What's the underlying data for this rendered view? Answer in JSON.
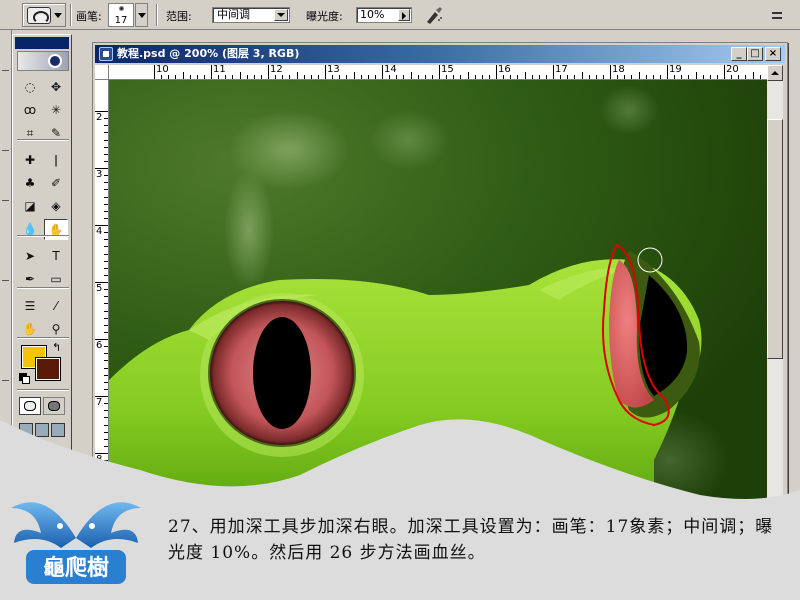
{
  "options_bar": {
    "tool_preset_icon": "burn-tool-icon",
    "brush_label": "画笔:",
    "brush_size": "17",
    "range_label": "范围:",
    "range_value": "中间调",
    "exposure_label": "曝光度:",
    "exposure_value": "10%",
    "airbrush_icon": "airbrush-icon"
  },
  "toolbox": {
    "tools": [
      {
        "name": "marquee-tool-icon",
        "glyph": "◌"
      },
      {
        "name": "move-tool-icon",
        "glyph": "✥"
      },
      {
        "name": "lasso-tool-icon",
        "glyph": "ꝏ"
      },
      {
        "name": "magic-wand-tool-icon",
        "glyph": "✳"
      },
      {
        "name": "crop-tool-icon",
        "glyph": "⌗"
      },
      {
        "name": "slice-tool-icon",
        "glyph": "✎"
      },
      {
        "name": "healing-brush-tool-icon",
        "glyph": "✚"
      },
      {
        "name": "brush-tool-icon",
        "glyph": "ǀ"
      },
      {
        "name": "clone-stamp-tool-icon",
        "glyph": "♣"
      },
      {
        "name": "history-brush-tool-icon",
        "glyph": "✐"
      },
      {
        "name": "eraser-tool-icon",
        "glyph": "◪"
      },
      {
        "name": "paint-bucket-tool-icon",
        "glyph": "◈"
      },
      {
        "name": "blur-tool-icon",
        "glyph": "💧"
      },
      {
        "name": "burn-tool-icon",
        "glyph": "✋"
      },
      {
        "name": "path-selection-tool-icon",
        "glyph": "➤"
      },
      {
        "name": "type-tool-icon",
        "glyph": "T"
      },
      {
        "name": "pen-tool-icon",
        "glyph": "✒"
      },
      {
        "name": "shape-tool-icon",
        "glyph": "▭"
      },
      {
        "name": "notes-tool-icon",
        "glyph": "☰"
      },
      {
        "name": "eyedropper-tool-icon",
        "glyph": "⁄"
      },
      {
        "name": "hand-tool-icon",
        "glyph": "✋"
      },
      {
        "name": "zoom-tool-icon",
        "glyph": "⚲"
      }
    ],
    "foreground_color": "#f5c400",
    "background_color": "#5a1a08"
  },
  "document": {
    "title": "教程.psd @ 200% (图层 3, RGB)",
    "minimize_label": "_",
    "maximize_label": "□",
    "close_label": "×",
    "ruler_h_labels": [
      "10",
      "11",
      "12",
      "13",
      "14",
      "15",
      "16",
      "17",
      "18",
      "19",
      "20"
    ],
    "ruler_v_labels": [
      "2",
      "3",
      "4",
      "5",
      "6",
      "7",
      "8"
    ]
  },
  "caption": {
    "text": "27、用加深工具步加深右眼。加深工具设置为：画笔：17象素；中间调；曝光度 10%。然后用 26 步方法画血丝。"
  },
  "logo": {
    "text": "龜爬樹"
  },
  "colors": {
    "frog_skin": "#8fd62a",
    "eye_iris": "#c2555a",
    "background_green": "#2d5a12",
    "selection_outline": "#e00000",
    "logo_blue": "#2a7fd0"
  }
}
